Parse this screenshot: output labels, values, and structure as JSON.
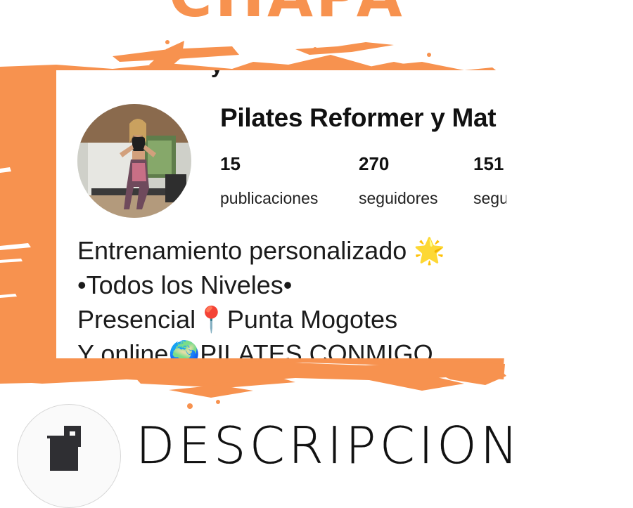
{
  "header": {
    "title": "CHAPA",
    "cut_text": "y"
  },
  "profile": {
    "name": "Pilates Reformer y Mat",
    "stats": [
      {
        "value": "15",
        "label": "publicaciones"
      },
      {
        "value": "270",
        "label": "seguidores"
      },
      {
        "value": "151",
        "label": "seguidos"
      }
    ],
    "bio": [
      "Entrenamiento personalizado 🌟",
      "•Todos los Niveles•",
      "Presencial📍Punta Mogotes",
      "Y online🌍PILATES CONMIGO"
    ]
  },
  "footer": {
    "title": "DESCRIPCION",
    "logo_icon": "building-icon"
  },
  "colors": {
    "accent": "#f7924f",
    "text": "#111111",
    "background": "#ffffff"
  }
}
